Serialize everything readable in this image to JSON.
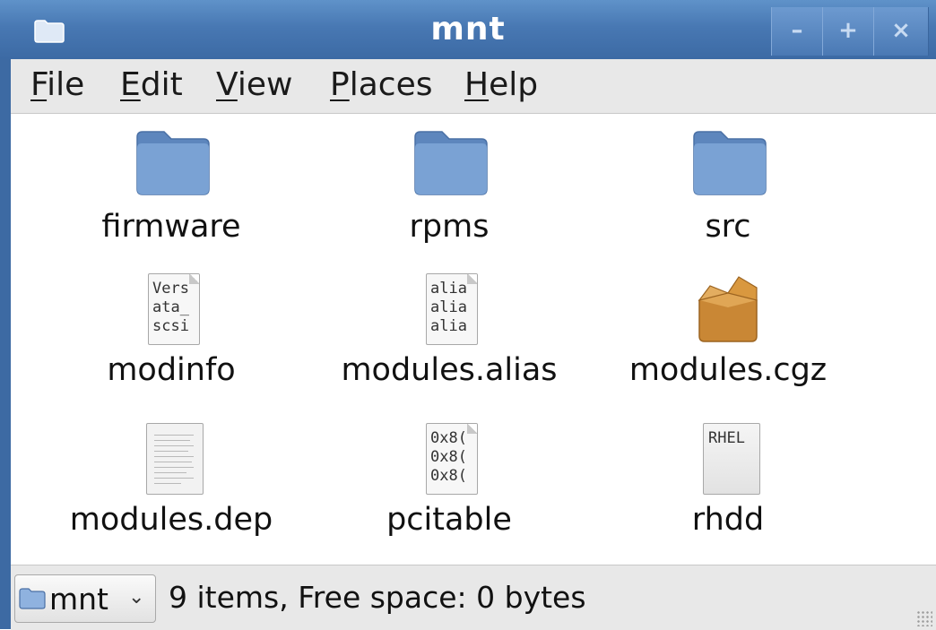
{
  "window": {
    "title": "mnt",
    "controls": {
      "minimize": "–",
      "maximize": "+",
      "close": "×"
    }
  },
  "menu": [
    {
      "underline": "F",
      "rest": "ile"
    },
    {
      "underline": "E",
      "rest": "dit"
    },
    {
      "underline": "V",
      "rest": "iew"
    },
    {
      "underline": "P",
      "rest": "laces"
    },
    {
      "underline": "H",
      "rest": "elp"
    }
  ],
  "files": [
    {
      "name": "firmware",
      "kind": "folder-icon"
    },
    {
      "name": "rpms",
      "kind": "folder-icon"
    },
    {
      "name": "src",
      "kind": "folder-icon"
    },
    {
      "name": "modinfo",
      "kind": "text-file-icon",
      "preview": [
        "Vers",
        "ata_",
        "scsi"
      ]
    },
    {
      "name": "modules.alias",
      "kind": "text-file-icon",
      "preview": [
        "alia",
        "alia",
        "alia"
      ]
    },
    {
      "name": "modules.cgz",
      "kind": "package-icon"
    },
    {
      "name": "modules.dep",
      "kind": "document-icon"
    },
    {
      "name": "pcitable",
      "kind": "text-file-icon",
      "preview": [
        "0x8(",
        "0x8(",
        "0x8("
      ]
    },
    {
      "name": "rhdd",
      "kind": "text-file-icon",
      "preview": [
        "RHEL"
      ]
    }
  ],
  "statusbar": {
    "location": "mnt",
    "info": "9 items, Free space: 0 bytes"
  },
  "colors": {
    "titlebar": "#4a7cb8",
    "folder": "#6f98cc",
    "package": "#c98a3a"
  }
}
